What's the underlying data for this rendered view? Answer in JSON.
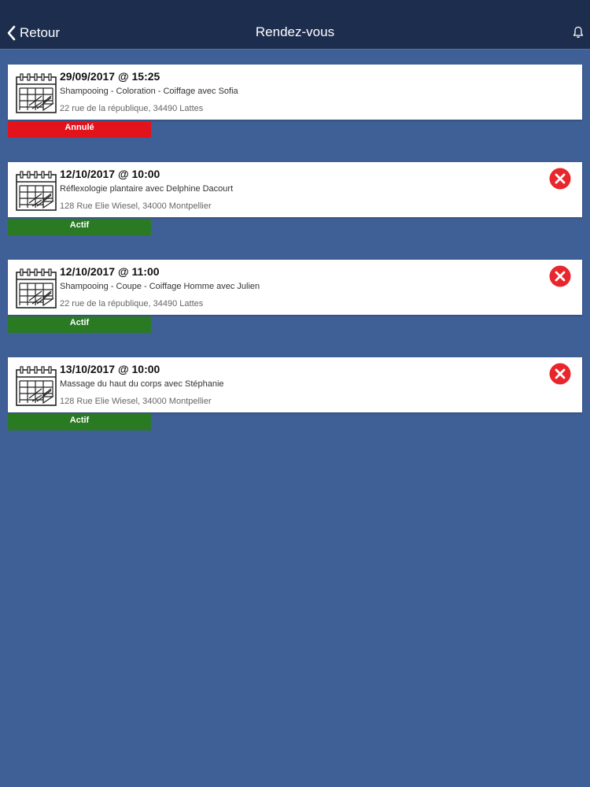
{
  "header": {
    "back_label": "Retour",
    "title": "Rendez-vous",
    "bell_icon": "bell-icon",
    "back_icon": "chevron-left-icon"
  },
  "colors": {
    "background": "#3f5f97",
    "navbar": "#1c2d4e",
    "status_cancelled": "#e2131b",
    "status_active": "#2a7a24",
    "cancel_button": "#e8262c"
  },
  "appointments": [
    {
      "datetime": "29/09/2017 @ 15:25",
      "service": "Shampooing - Coloration - Coiffage avec Sofia",
      "address": "22 rue de la république, 34490 Lattes",
      "status": "Annulé",
      "cancellable": false
    },
    {
      "datetime": "12/10/2017 @ 10:00",
      "service": "Réflexologie plantaire avec Delphine Dacourt",
      "address": "128 Rue Elie Wiesel, 34000 Montpellier",
      "status": "Actif",
      "cancellable": true
    },
    {
      "datetime": "12/10/2017 @ 11:00",
      "service": "Shampooing - Coupe - Coiffage Homme avec Julien",
      "address": "22 rue de la république, 34490 Lattes",
      "status": "Actif",
      "cancellable": true
    },
    {
      "datetime": "13/10/2017 @ 10:00",
      "service": "Massage du haut du corps avec Stéphanie",
      "address": "128 Rue Elie Wiesel, 34000 Montpellier",
      "status": "Actif",
      "cancellable": true
    }
  ]
}
